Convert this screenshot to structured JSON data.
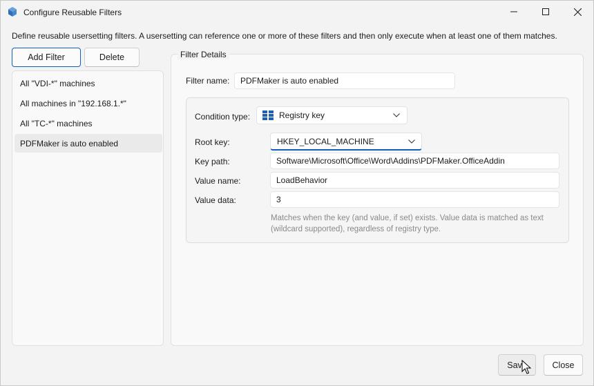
{
  "window": {
    "title": "Configure Reusable Filters",
    "description": "Define reusable usersetting filters. A usersetting can reference one or more of these filters and then only execute when at least one of them matches."
  },
  "toolbar": {
    "add_label": "Add Filter",
    "delete_label": "Delete"
  },
  "filters": [
    {
      "label": "All \"VDI-*\" machines",
      "selected": false
    },
    {
      "label": "All machines in \"192.168.1.*\"",
      "selected": false
    },
    {
      "label": "All \"TC-*\" machines",
      "selected": false
    },
    {
      "label": "PDFMaker is auto enabled",
      "selected": true
    }
  ],
  "details": {
    "group_title": "Filter Details",
    "filter_name_label": "Filter name:",
    "filter_name_value": "PDFMaker is auto enabled",
    "condition_type_label": "Condition type:",
    "condition_type_value": "Registry key",
    "root_key_label": "Root key:",
    "root_key_value": "HKEY_LOCAL_MACHINE",
    "key_path_label": "Key path:",
    "key_path_value": "Software\\Microsoft\\Office\\Word\\Addins\\PDFMaker.OfficeAddin",
    "value_name_label": "Value name:",
    "value_name_value": "LoadBehavior",
    "value_data_label": "Value data:",
    "value_data_value": "3",
    "hint_line1": "Matches when the key (and value, if set) exists. Value data is matched as text",
    "hint_line2": "(wildcard supported), regardless of registry type."
  },
  "footer": {
    "save_label": "Save",
    "close_label": "Close"
  },
  "colors": {
    "accent": "#0f5fb8",
    "registry_icon": "#1f5fb0"
  }
}
